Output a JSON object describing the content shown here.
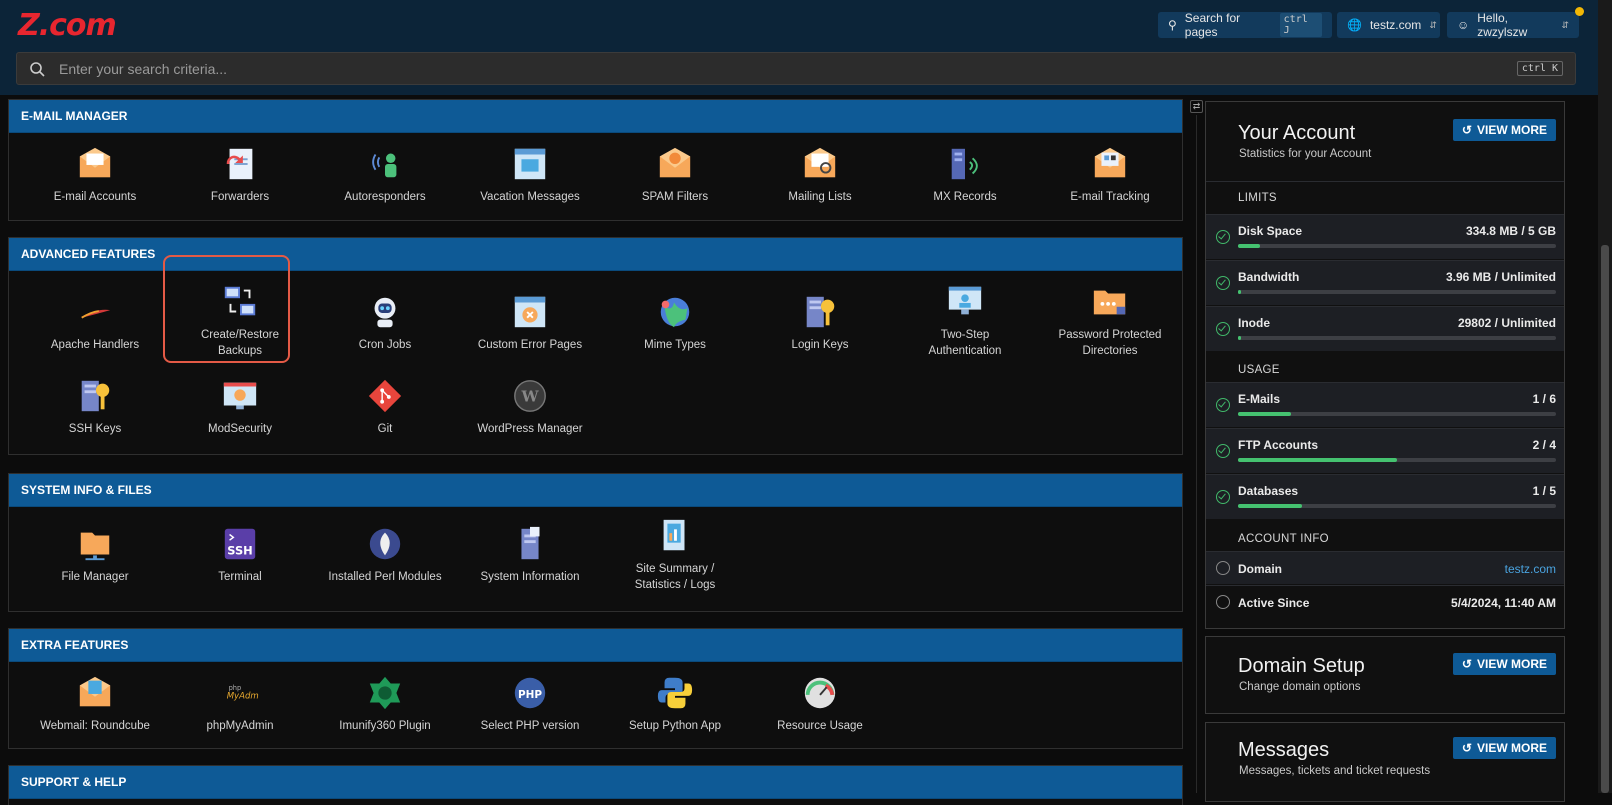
{
  "header": {
    "logo": "Z.com",
    "search_pages_label": "Search for pages",
    "search_pages_shortcut": "ctrl J",
    "domain_selector": "testz.com",
    "user_greeting": "Hello, zwzylszw"
  },
  "search": {
    "placeholder": "Enter your search criteria...",
    "shortcut": "ctrl K"
  },
  "sections": {
    "email": {
      "title": "E-MAIL MANAGER",
      "items": [
        "E-mail Accounts",
        "Forwarders",
        "Autoresponders",
        "Vacation Messages",
        "SPAM Filters",
        "Mailing Lists",
        "MX Records",
        "E-mail Tracking"
      ]
    },
    "advanced": {
      "title": "ADVANCED FEATURES",
      "items": [
        "Apache Handlers",
        "Create/Restore Backups",
        "Cron Jobs",
        "Custom Error Pages",
        "Mime Types",
        "Login Keys",
        "Two-Step Authentication",
        "Password Protected Directories",
        "SSH Keys",
        "ModSecurity",
        "Git",
        "WordPress Manager"
      ]
    },
    "system": {
      "title": "SYSTEM INFO & FILES",
      "items": [
        "File Manager",
        "Terminal",
        "Installed Perl Modules",
        "System Information",
        "Site Summary / Statistics / Logs"
      ]
    },
    "extra": {
      "title": "EXTRA FEATURES",
      "items": [
        "Webmail: Roundcube",
        "phpMyAdmin",
        "Imunify360 Plugin",
        "Select PHP version",
        "Setup Python App",
        "Resource Usage"
      ]
    },
    "support": {
      "title": "SUPPORT & HELP"
    }
  },
  "account_panel": {
    "title": "Your Account",
    "subtitle": "Statistics for your Account",
    "view_more": "VIEW MORE",
    "limits_label": "LIMITS",
    "limits": [
      {
        "name": "Disk Space",
        "value": "334.8 MB / 5 GB",
        "fraction": 0.07
      },
      {
        "name": "Bandwidth",
        "value": "3.96 MB / Unlimited",
        "fraction": 0.01
      },
      {
        "name": "Inode",
        "value": "29802 / Unlimited",
        "fraction": 0.01
      }
    ],
    "usage_label": "USAGE",
    "usage": [
      {
        "name": "E-Mails",
        "value": "1 / 6",
        "fraction": 0.167
      },
      {
        "name": "FTP Accounts",
        "value": "2 / 4",
        "fraction": 0.5
      },
      {
        "name": "Databases",
        "value": "1 / 5",
        "fraction": 0.2
      }
    ],
    "account_info_label": "ACCOUNT INFO",
    "domain_label": "Domain",
    "domain_value": "testz.com",
    "active_since_label": "Active Since",
    "active_since_value": "5/4/2024, 11:40 AM"
  },
  "domain_panel": {
    "title": "Domain Setup",
    "subtitle": "Change domain options",
    "view_more": "VIEW MORE"
  },
  "messages_panel": {
    "title": "Messages",
    "subtitle": "Messages, tickets and ticket requests",
    "view_more": "VIEW MORE"
  },
  "colors": {
    "brand_red": "#e8262f",
    "section_blue": "#0e5a96",
    "bar_green": "#45c270",
    "highlight": "#e45a46"
  }
}
